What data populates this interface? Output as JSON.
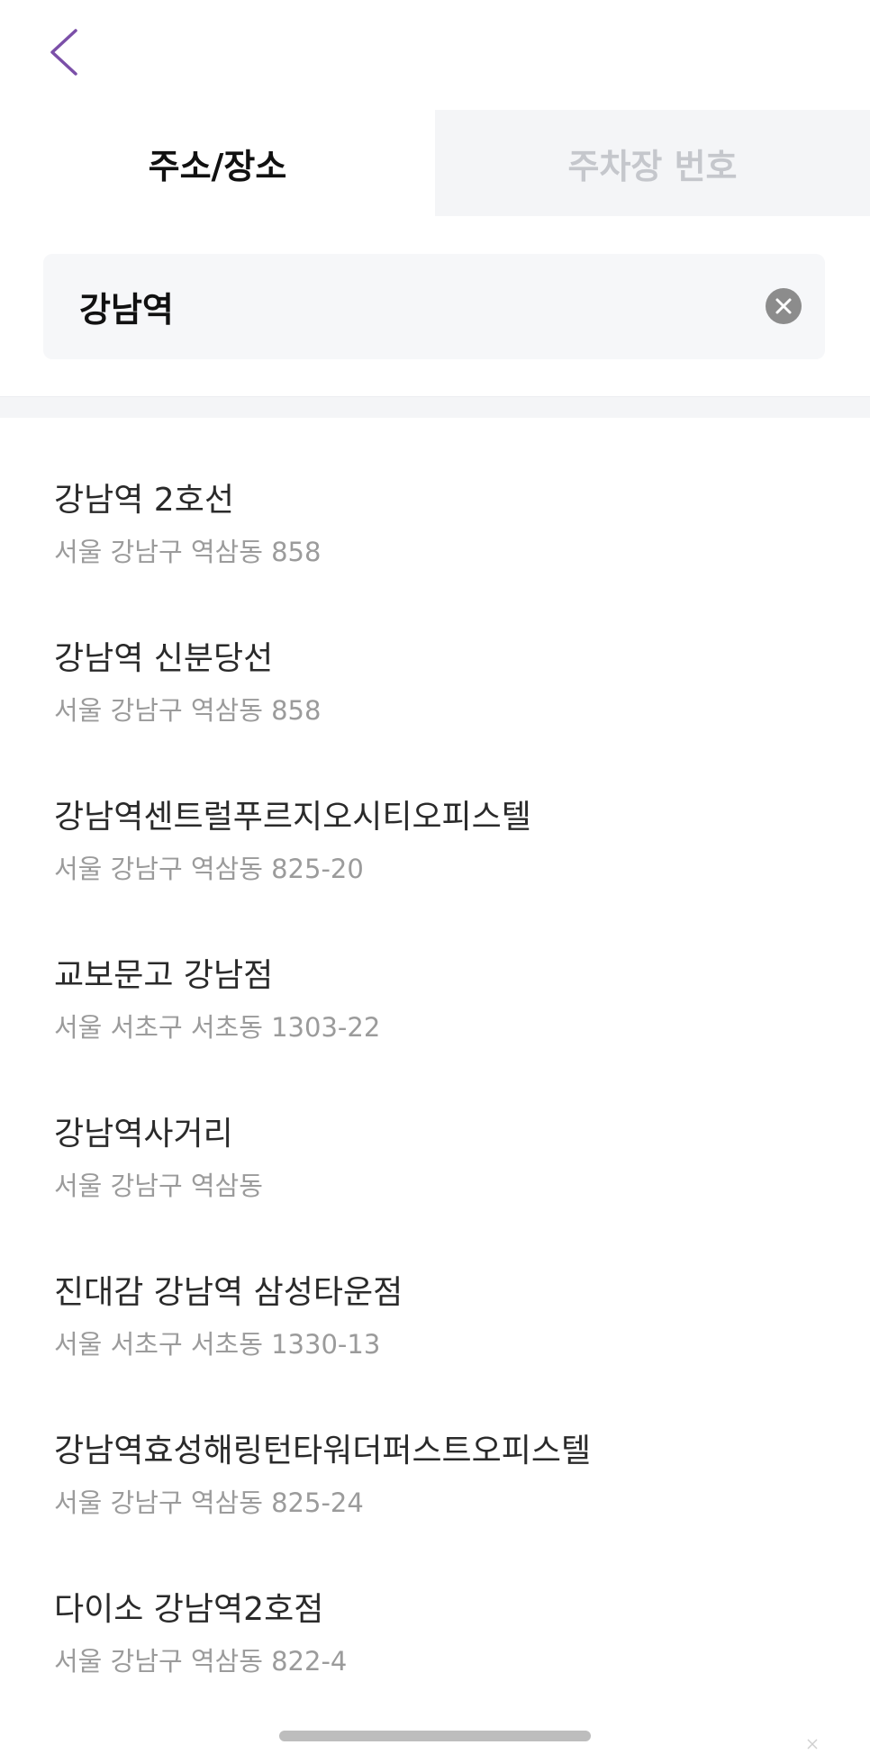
{
  "header": {
    "back_icon": "chevron-left-icon",
    "accent_color": "#7b4fa8"
  },
  "tabs": [
    {
      "label": "주소/장소",
      "active": true
    },
    {
      "label": "주차장 번호",
      "active": false
    }
  ],
  "search": {
    "value": "강남역",
    "clear_icon": "clear-circle-icon"
  },
  "results": [
    {
      "name": "강남역 2호선",
      "address": "서울 강남구 역삼동 858"
    },
    {
      "name": "강남역 신분당선",
      "address": "서울 강남구 역삼동 858"
    },
    {
      "name": "강남역센트럴푸르지오시티오피스텔",
      "address": "서울 강남구 역삼동 825-20"
    },
    {
      "name": "교보문고 강남점",
      "address": "서울 서초구 서초동 1303-22"
    },
    {
      "name": "강남역사거리",
      "address": "서울 강남구 역삼동"
    },
    {
      "name": "진대감 강남역 삼성타운점",
      "address": "서울 서초구 서초동 1330-13"
    },
    {
      "name": "강남역효성해링턴타워더퍼스트오피스텔",
      "address": "서울 강남구 역삼동 825-24"
    },
    {
      "name": "다이소 강남역2호점",
      "address": "서울 강남구 역삼동 822-4"
    }
  ]
}
